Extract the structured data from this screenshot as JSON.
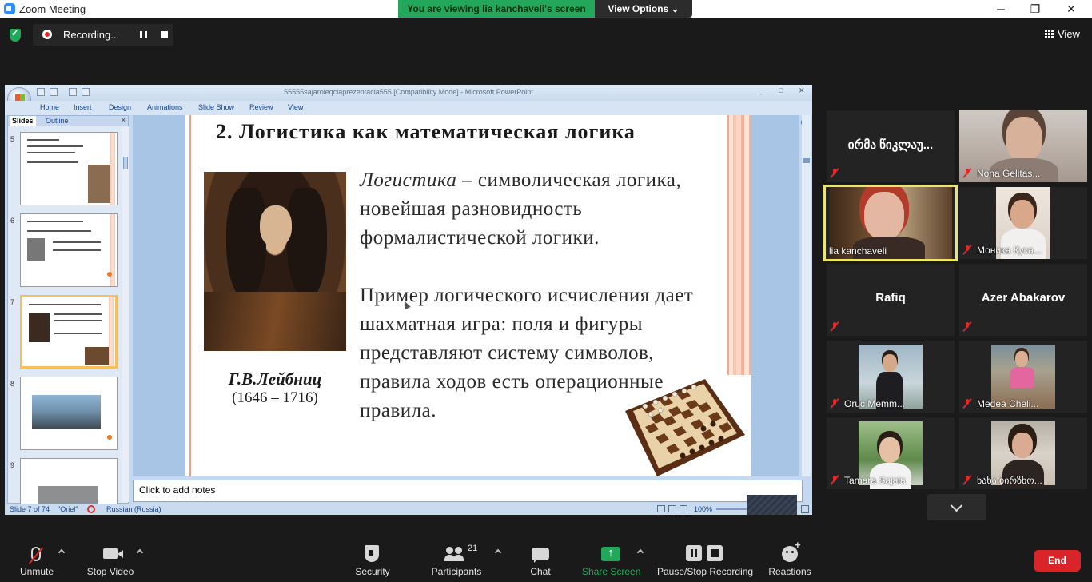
{
  "window": {
    "title": "Zoom Meeting",
    "minimize": "─",
    "restore": "❐",
    "close": "✕"
  },
  "banner": {
    "viewing": "You are viewing lia kanchaveli's screen",
    "view_options": "View Options ⌄"
  },
  "recording": {
    "label": "Recording..."
  },
  "view_button": {
    "label": "View"
  },
  "powerpoint": {
    "title": "55555sajaroleqciaprezentacia555 [Compatibility Mode] - Microsoft PowerPoint",
    "window_controls": [
      "_",
      "□",
      "✕"
    ],
    "ribbon_tabs": [
      "Home",
      "Insert",
      "Design",
      "Animations",
      "Slide Show",
      "Review",
      "View"
    ],
    "pane_tabs": {
      "slides": "Slides",
      "outline": "Outline",
      "close": "×"
    },
    "thumbnails": [
      {
        "num": "5"
      },
      {
        "num": "6"
      },
      {
        "num": "7",
        "selected": true
      },
      {
        "num": "8"
      },
      {
        "num": "9"
      }
    ],
    "notes_placeholder": "Click to add notes",
    "status": {
      "slide": "Slide 7 of 74",
      "theme": "\"Oriel\"",
      "language": "Russian (Russia)",
      "zoom": "100%"
    }
  },
  "slide": {
    "title": "2. Логистика как математическая логика",
    "portrait_name": "Г.В.Лейбниц",
    "portrait_years": "(1646 – 1716)",
    "para1_term": "Логистика",
    "para1_rest": " – символическая логика, новейшая разновидность формалистической логики.",
    "para2": "Пример логического исчисления дает шахматная игра: поля и фигуры представляют систему символов, правила ходов есть операционные правила."
  },
  "participants": [
    {
      "id": "irma",
      "name": "ირმა წიკლაუ...",
      "video": false,
      "muted": true
    },
    {
      "id": "nona",
      "name": "Nona Gelitas...",
      "video": true,
      "muted": true
    },
    {
      "id": "lia",
      "name": "lia kanchaveli",
      "video": true,
      "muted": false,
      "active": true
    },
    {
      "id": "monika",
      "name": "Моника Кука...",
      "video": true,
      "muted": true
    },
    {
      "id": "rafiq",
      "name": "Rafiq",
      "video": false,
      "muted": true
    },
    {
      "id": "azer",
      "name": "Azer Abakarov",
      "video": false,
      "muted": true
    },
    {
      "id": "oruc",
      "name": "Oruc Memm...",
      "video": true,
      "muted": true
    },
    {
      "id": "medea",
      "name": "Medea Cheli...",
      "video": true,
      "muted": true
    },
    {
      "id": "tamara",
      "name": "Tamara Sajaia",
      "video": true,
      "muted": true
    },
    {
      "id": "nana",
      "name": "ნანა ბირზნო...",
      "video": true,
      "muted": true
    }
  ],
  "toolbar": {
    "unmute": "Unmute",
    "stop_video": "Stop Video",
    "security": "Security",
    "participants": "Participants",
    "participants_count": "21",
    "chat": "Chat",
    "share_screen": "Share Screen",
    "pause_stop_recording": "Pause/Stop Recording",
    "reactions": "Reactions",
    "end": "End"
  },
  "colors": {
    "zoom_bg": "#1a1a1a",
    "banner_green": "#23a85b",
    "active_speaker_border": "#e9e66b",
    "end_red": "#d9252a",
    "mute_red": "#e02828"
  }
}
